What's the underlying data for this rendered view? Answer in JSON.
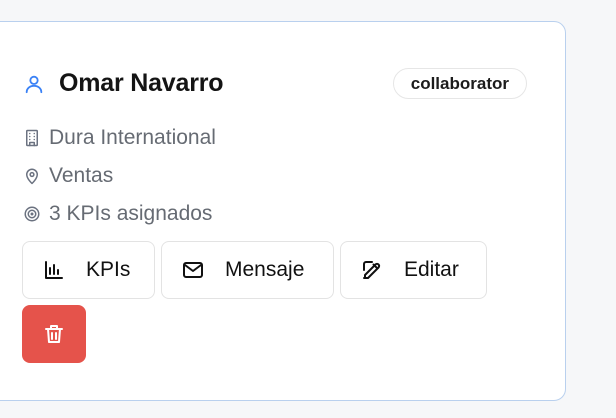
{
  "card": {
    "name": "Omar Navarro",
    "role_badge": "collaborator",
    "company": "Dura International",
    "department": "Ventas",
    "kpi_summary": "3 KPIs asignados"
  },
  "actions": {
    "kpis_label": "KPIs",
    "message_label": "Mensaje",
    "edit_label": "Editar"
  },
  "colors": {
    "accent": "#3b82f6",
    "delete": "#e5534b",
    "card_border": "#b9d0ee"
  },
  "icons": {
    "user": "user-icon",
    "company": "building-icon",
    "location": "map-pin-icon",
    "target": "target-icon",
    "chart": "bar-chart-icon",
    "mail": "mail-icon",
    "edit": "edit-icon",
    "delete": "trash-icon"
  }
}
